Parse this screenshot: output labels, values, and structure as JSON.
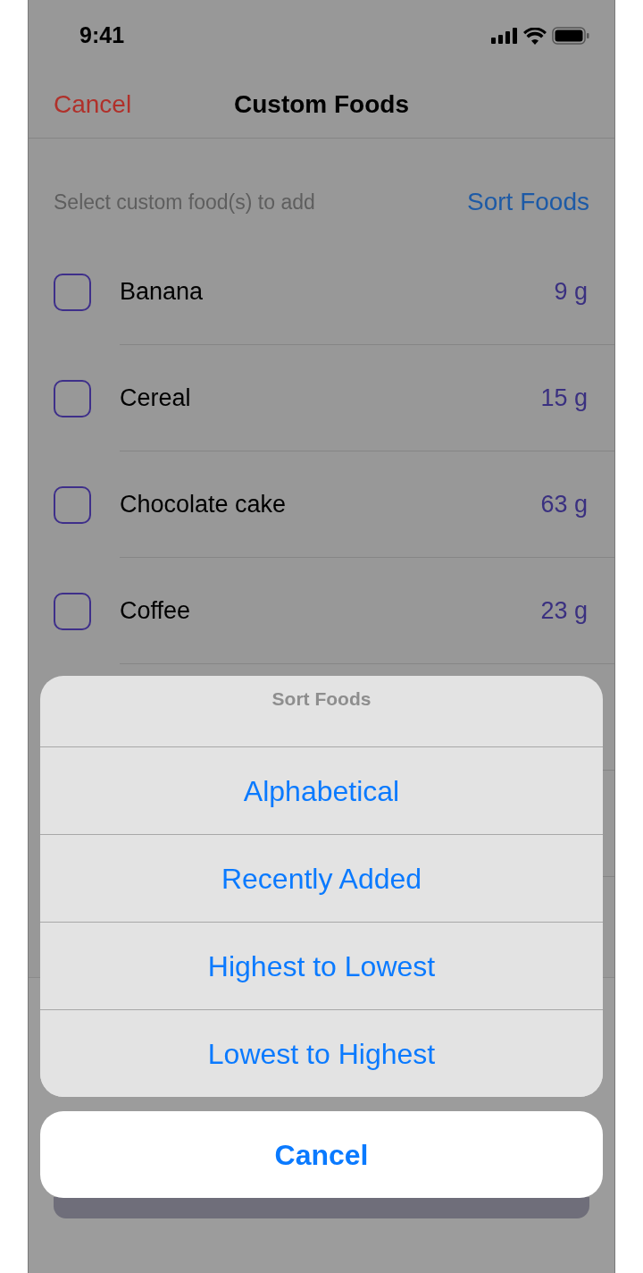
{
  "status_bar": {
    "time": "9:41"
  },
  "nav_bar": {
    "cancel": "Cancel",
    "title": "Custom Foods"
  },
  "subheader": {
    "hint": "Select custom food(s) to add",
    "sort_button": "Sort Foods"
  },
  "foods": [
    {
      "name": "Banana",
      "amount": "9 g",
      "checked": false
    },
    {
      "name": "Cereal",
      "amount": "15 g",
      "checked": false
    },
    {
      "name": "Chocolate cake",
      "amount": "63 g",
      "checked": false
    },
    {
      "name": "Coffee",
      "amount": "23 g",
      "checked": false
    }
  ],
  "action_sheet": {
    "title": "Sort Foods",
    "options": [
      "Alphabetical",
      "Recently Added",
      "Highest to Lowest",
      "Lowest to Highest"
    ],
    "cancel": "Cancel"
  }
}
